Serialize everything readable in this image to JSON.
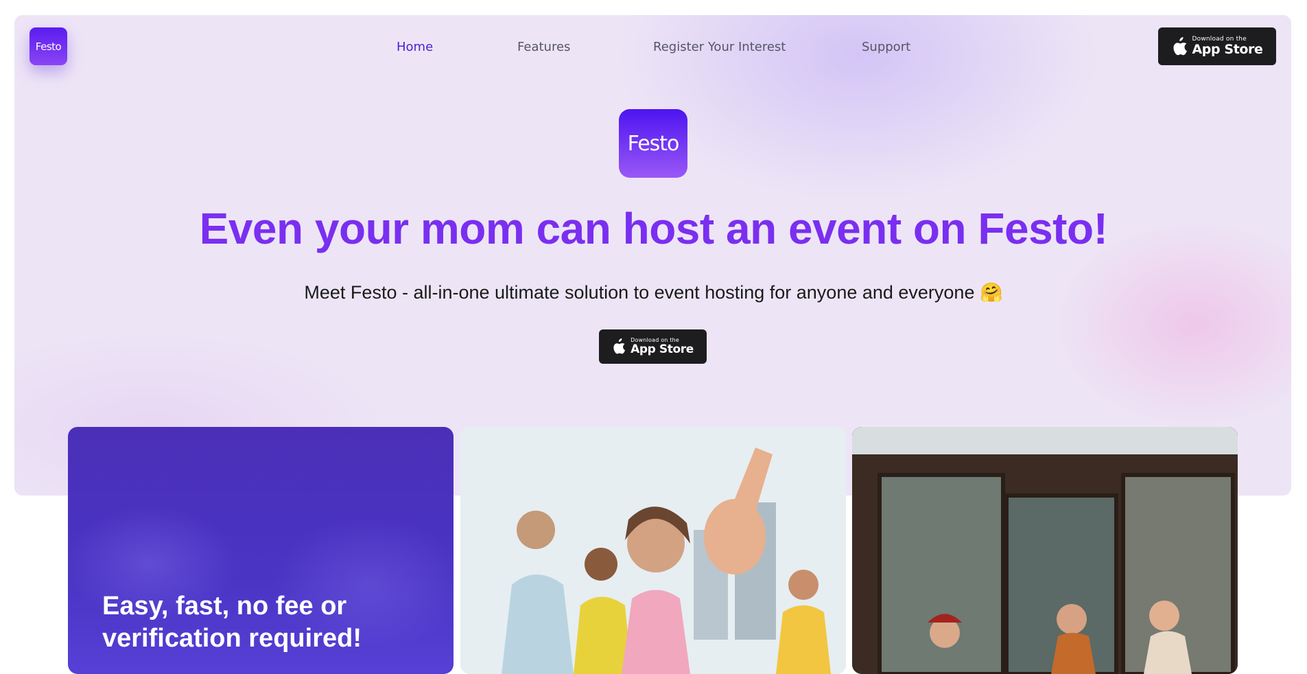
{
  "brand": {
    "logo_text": "Festo"
  },
  "nav": {
    "items": [
      {
        "label": "Home",
        "active": true
      },
      {
        "label": "Features",
        "active": false
      },
      {
        "label": "Register Your Interest",
        "active": false
      },
      {
        "label": "Support",
        "active": false
      }
    ]
  },
  "appstore_badge": {
    "line1": "Download on the",
    "line2": "App Store"
  },
  "hero": {
    "logo_text": "Festo",
    "headline": "Even your mom can host an event on Festo!",
    "subheadline": "Meet Festo - all-in-one ultimate solution to event hosting for anyone and everyone 🤗"
  },
  "cards": [
    {
      "title": "Easy, fast, no fee or verification required!"
    },
    {
      "image": "party-friends-photo"
    },
    {
      "image": "outdoor-gathering-photo"
    }
  ],
  "colors": {
    "accent": "#7a2ff0",
    "nav_active": "#4a1fd6",
    "badge_bg": "#1d1d1f",
    "card_purple": "#4a34c4"
  }
}
